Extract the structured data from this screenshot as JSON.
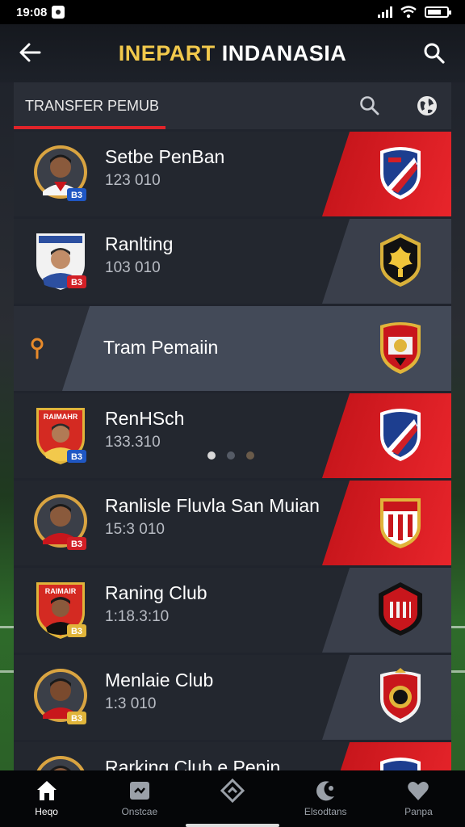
{
  "status": {
    "time": "19:08"
  },
  "header": {
    "title_part1": "INEPART",
    "title_part2": "INDANASIA"
  },
  "subheader": {
    "label": "TRANSFER PEMUB"
  },
  "rows": [
    {
      "name": "Setbe PenBan",
      "meta": "123 010",
      "slant": "red",
      "avatar_color": "#d9a441",
      "badge": "B3"
    },
    {
      "name": "Ranlting",
      "meta": "103 010",
      "slant": "grey",
      "avatar_color": "#2c4fa0",
      "badge": "B3"
    },
    {
      "name": "RenHSch",
      "meta": "133.310",
      "slant": "red",
      "avatar_color": "#d42a22",
      "badge": "B3"
    },
    {
      "name": "Ranlisle Fluvla San Muian",
      "meta": "15:3 010",
      "slant": "red",
      "avatar_color": "#d9a441",
      "badge": "B3"
    },
    {
      "name": "Raning Club",
      "meta": "1:18.3:10",
      "slant": "grey",
      "avatar_color": "#d42a22",
      "badge": "B3"
    },
    {
      "name": "Menlaie Club",
      "meta": "1:3 010",
      "slant": "grey",
      "avatar_color": "#d9a441",
      "badge": "B3"
    },
    {
      "name": "Rarking Club e Penin",
      "meta": "",
      "slant": "red",
      "avatar_color": "#d9a441",
      "badge": ""
    }
  ],
  "section": {
    "title": "Tram Pemaiin"
  },
  "nav": [
    {
      "label": "Heqo",
      "icon": "home-icon"
    },
    {
      "label": "Onstcae",
      "icon": "card-icon"
    },
    {
      "label": "",
      "icon": "diamond-icon"
    },
    {
      "label": "Elsodtans",
      "icon": "moon-icon"
    },
    {
      "label": "Panpa",
      "icon": "heart-icon"
    }
  ],
  "colors": {
    "accent": "#e0242a",
    "title_yellow": "#f2c94c"
  }
}
